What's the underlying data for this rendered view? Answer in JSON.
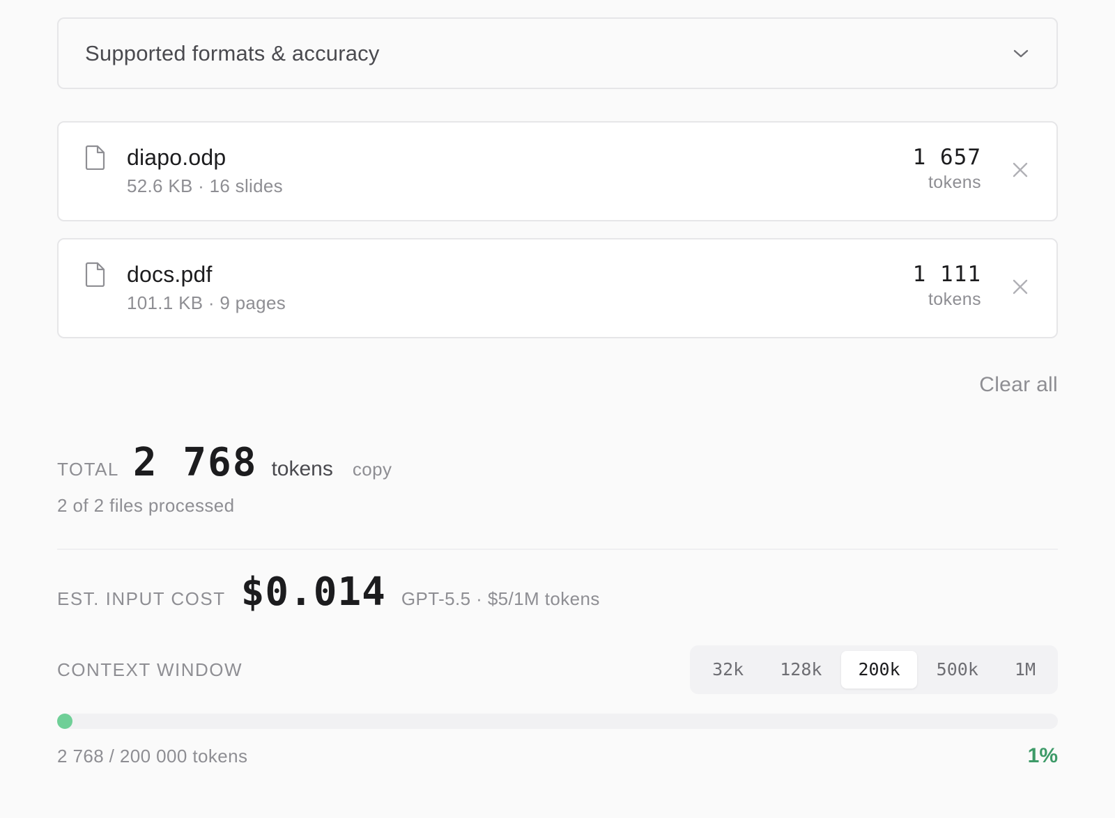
{
  "accordion": {
    "title": "Supported formats & accuracy",
    "icon": "chevron-down-icon"
  },
  "files": [
    {
      "name": "diapo.odp",
      "meta": "52.6 KB · 16 slides",
      "tokens": "1 657",
      "tokens_label": "tokens",
      "icon": "file-icon",
      "remove_icon": "close-icon"
    },
    {
      "name": "docs.pdf",
      "meta": "101.1 KB · 9 pages",
      "tokens": "1 111",
      "tokens_label": "tokens",
      "icon": "file-icon",
      "remove_icon": "close-icon"
    }
  ],
  "actions": {
    "clear_all": "Clear all"
  },
  "total": {
    "label": "TOTAL",
    "value": "2 768",
    "unit": "tokens",
    "copy": "copy",
    "processed": "2 of 2 files processed"
  },
  "cost": {
    "label": "EST. INPUT COST",
    "value": "$0.014",
    "model": "GPT-5.5 · $5/1M tokens"
  },
  "context": {
    "label": "CONTEXT WINDOW",
    "options": [
      "32k",
      "128k",
      "200k",
      "500k",
      "1M"
    ],
    "selected": "200k",
    "usage_text": "2 768 / 200 000 tokens",
    "percent_label": "1%",
    "fill_fraction": 0.0138
  },
  "colors": {
    "accent_green": "#6fcf97",
    "percent_green": "#3d9a68",
    "background": "#fafafa"
  }
}
